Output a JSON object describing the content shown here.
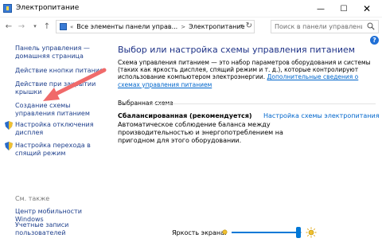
{
  "window": {
    "title": "Электропитание",
    "minimize_glyph": "—",
    "maximize_glyph": "☐",
    "close_glyph": "✕"
  },
  "address": {
    "back_glyph": "←",
    "forward_glyph": "→",
    "history_glyph": "▾",
    "up_glyph": "↑",
    "breadcrumb_overflow": "«",
    "breadcrumb": [
      "Все элементы панели управ...",
      "Электропитание"
    ],
    "breadcrumb_sep": ">",
    "dropdown_glyph": "▾",
    "refresh_glyph": "↻",
    "search_placeholder": "Поиск в панели управления"
  },
  "sidebar": {
    "items": [
      {
        "label": "Панель управления — домашняя страница"
      },
      {
        "label": "Действие кнопки питания"
      },
      {
        "label": "Действие при закрытии крышки"
      },
      {
        "label": "Создание схемы управления питанием"
      },
      {
        "label": "Настройка отключения дисплея",
        "icon": "shield-icon"
      },
      {
        "label": "Настройка перехода в спящий режим",
        "icon": "shield-icon"
      }
    ],
    "see_also": "См. также",
    "see_also_items": [
      {
        "label": "Центр мобильности Windows"
      },
      {
        "label": "Учетные записи пользователей"
      }
    ]
  },
  "main": {
    "help_glyph": "?",
    "title": "Выбор или настройка схемы управления питанием",
    "description": "Схема управления питанием — это набор параметров оборудования и системы (таких как яркость дисплея, спящий режим и т. д.), которые контролируют использование компьютером электроэнергии.",
    "description_link": "Дополнительные сведения о схемах управления питанием",
    "group_label": "Выбранная схема",
    "plan": {
      "name": "Сбалансированная (рекомендуется)",
      "settings_link": "Настройка схемы электропитания",
      "description": "Автоматическое соблюдение баланса между производительностью и энергопотреблением на пригодном для этого оборудовании."
    }
  },
  "brightness": {
    "label": "Яркость экрана:",
    "level": 0.95
  },
  "colors": {
    "link": "#1e3f8c",
    "title": "#1e3287",
    "accent": "#0078d7",
    "arrow": "#f06a6a"
  }
}
